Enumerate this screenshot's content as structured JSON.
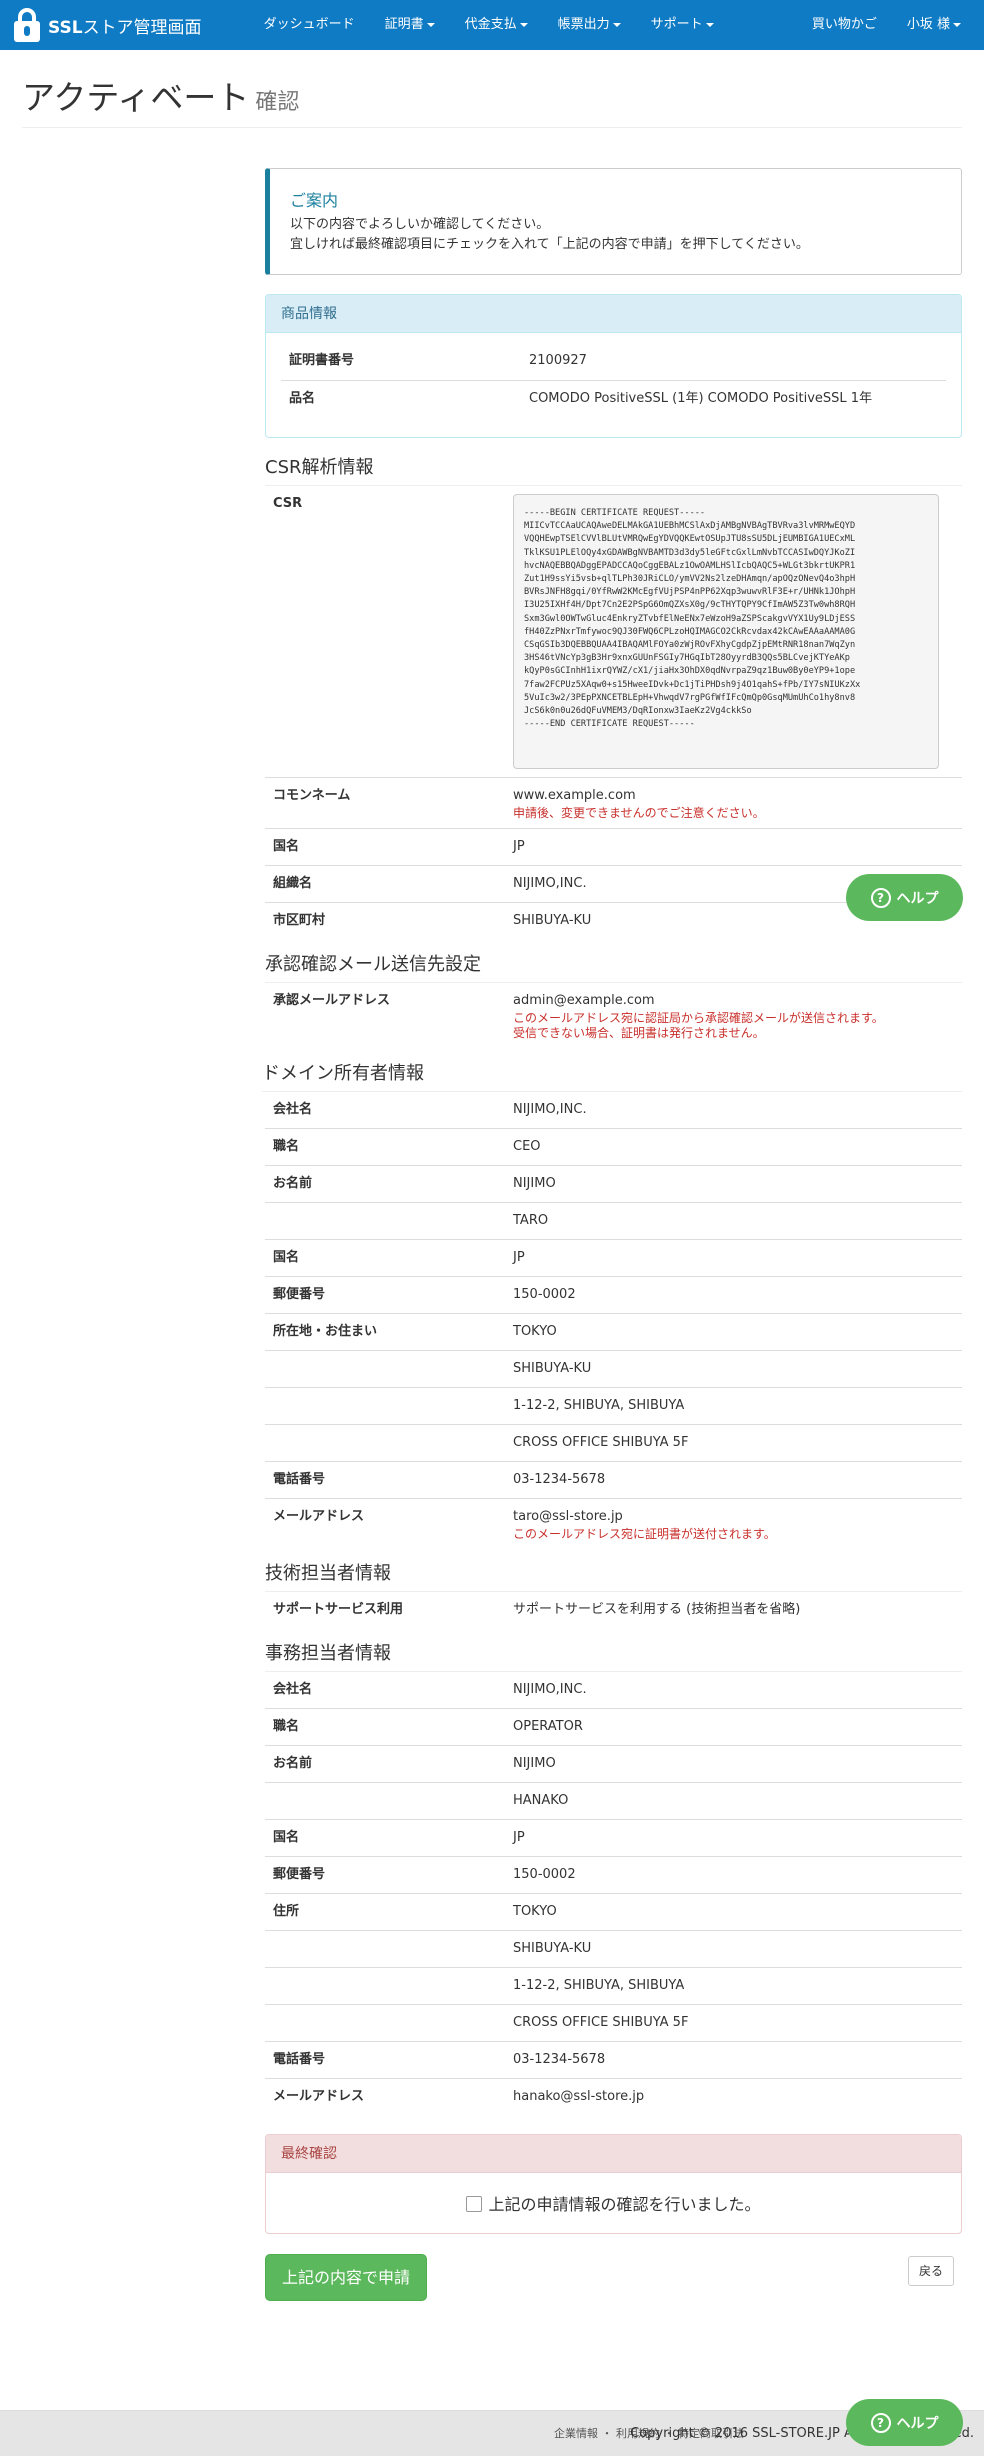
{
  "navbar": {
    "brand": "SSL",
    "brand_sub": "ストア管理画面",
    "items": [
      "ダッシュボード",
      "証明書",
      "代金支払",
      "帳票出力",
      "サポート"
    ],
    "right_items": [
      "買い物かご",
      "小坂 様"
    ]
  },
  "page": {
    "title": "アクティベート",
    "subtitle": "確認"
  },
  "notice": {
    "title": "ご案内",
    "line1": "以下の内容でよろしいか確認してください。",
    "line2": "宜しければ最終確認項目にチェックを入れて「上記の内容で申請」を押下してください。"
  },
  "product": {
    "heading": "商品情報",
    "rows": [
      {
        "label": "証明書番号",
        "value": "2100927"
      },
      {
        "label": "品名",
        "value": "COMODO PositiveSSL (1年) COMODO PositiveSSL 1年"
      }
    ]
  },
  "csr": {
    "heading": "CSR解析情報",
    "csr_label": "CSR",
    "csr_text": "-----BEGIN CERTIFICATE REQUEST-----\nMIICvTCCAaUCAQAweDELMAkGA1UEBhMCSlAxDjAMBgNVBAgTBVRva3lvMRMwEQYD\nVQQHEwpTSElCVVlBLUtVMRQwEgYDVQQKEwtOSUpJTU8sSU5DLjEUMBIGA1UECxML\nTklKSU1PLElOQy4xGDAWBgNVBAMTD3d3dy5leGFtcGxlLmNvbTCCASIwDQYJKoZI\nhvcNAQEBBQADggEPADCCAQoCggEBALz1OwOAMLHSlIcbQAQC5+WLGt3bkrtUKPR1\nZut1H9ssYi5vsb+qlTLPh30JRiCLO/ymVV2Ns2lzeDHAmqn/apOQzONevQ4o3hpH\nBVRsJNFH8gqi/0YfRwW2KMcEgfVUjPSP4nPP62Xqp3wuwvRlF3E+r/UHNk1JOhpH\nI3U25IXHf4H/Dpt7Cn2E2PSpG6OmQZXsX0g/9cTHYTQPY9CfImAW5Z3Tw0wh8RQH\nSxm3Gwl0OWTwGluc4EnkryZTvbfElNeENx7eWzoH9aZSPScakgvVYX1Uy9LDjESS\nfH40ZzPNxrTmfywoc9QJ30FWQ6CPLzoHQIMAGCO2CkRcvdax42kCAwEAAaAAMA0G\nCSqGSIb3DQEBBQUAA4IBAQAMlFOYa0zWjROvFXhyCgdpZjpEMtRNR18nan7WqZyn\n3HS46tVNcYp3gB3Hr9xnxGUUnFSGIy7HGqIbT28OyyrdB3QQs5BLCvejKTYeAKp\nkQyP0sGCInhH1ixrQYWZ/cX1/jiaHx3OhDX0qdNvrpaZ9qz1Buw0By0eYP9+1ope\n7faw2FCPUz5XAqw0+s15HweeIDvk+Dc1jTiPHDsh9j4O1qahS+fPb/IY7sNIUKzXx\n5VuIc3w2/3PEpPXNCETBLEpH+VhwqdV7rgPGfWfIFcQmQp0GsqMUmUhCo1hy8nv8\nJcS6k0n0u26dQFuVMEM3/DqRIonxw3IaeKz2Vg4ckkSo\n-----END CERTIFICATE REQUEST-----",
    "rows": [
      {
        "label": "コモンネーム",
        "value": "www.example.com",
        "note": "申請後、変更できませんのでご注意ください。"
      },
      {
        "label": "国名",
        "value": "JP"
      },
      {
        "label": "組織名",
        "value": "NIJIMO,INC."
      },
      {
        "label": "市区町村",
        "value": "SHIBUYA-KU"
      }
    ]
  },
  "approval": {
    "heading": "承認確認メール送信先設定",
    "label": "承認メールアドレス",
    "value": "admin@example.com",
    "note1": "このメールアドレス宛に認証局から承認確認メールが送信されます。",
    "note2": "受信できない場合、証明書は発行されません。"
  },
  "owner": {
    "heading": "ドメイン所有者情報",
    "company_label": "会社名",
    "company": "NIJIMO,INC.",
    "title_label": "職名",
    "title": "CEO",
    "name_label": "お名前",
    "last_name": "NIJIMO",
    "first_name": "TARO",
    "country_label": "国名",
    "country": "JP",
    "zip_label": "郵便番号",
    "zip": "150-0002",
    "address_label": "所在地・お住まい",
    "address": [
      "TOKYO",
      "SHIBUYA-KU",
      "1-12-2, SHIBUYA, SHIBUYA",
      "CROSS OFFICE SHIBUYA 5F"
    ],
    "tel_label": "電話番号",
    "tel": "03-1234-5678",
    "mail_label": "メールアドレス",
    "mail": "taro@ssl-store.jp",
    "mail_note": "このメールアドレス宛に証明書が送付されます。"
  },
  "tech": {
    "heading": "技術担当者情報",
    "label": "サポートサービス利用",
    "value": "サポートサービスを利用する (技術担当者を省略)"
  },
  "admin": {
    "heading": "事務担当者情報",
    "company_label": "会社名",
    "company": "NIJIMO,INC.",
    "title_label": "職名",
    "title": "OPERATOR",
    "name_label": "お名前",
    "last_name": "NIJIMO",
    "first_name": "HANAKO",
    "country_label": "国名",
    "country": "JP",
    "zip_label": "郵便番号",
    "zip": "150-0002",
    "address_label": "住所",
    "address": [
      "TOKYO",
      "SHIBUYA-KU",
      "1-12-2, SHIBUYA, SHIBUYA",
      "CROSS OFFICE SHIBUYA 5F"
    ],
    "tel_label": "電話番号",
    "tel": "03-1234-5678",
    "mail_label": "メールアドレス",
    "mail": "hanako@ssl-store.jp"
  },
  "final": {
    "heading": "最終確認",
    "checkbox_label": "上記の申請情報の確認を行いました。",
    "checked": false
  },
  "actions": {
    "submit": "上記の内容で申請",
    "back": "戻る"
  },
  "help": {
    "label": "ヘルプ",
    "q": "?"
  },
  "footer": {
    "links": "企業情報 ・ 利用規約 ・ 特定商取引法",
    "copyright": "Copyright © 2016 SSL-STORE.JP All Rights Reserved."
  }
}
